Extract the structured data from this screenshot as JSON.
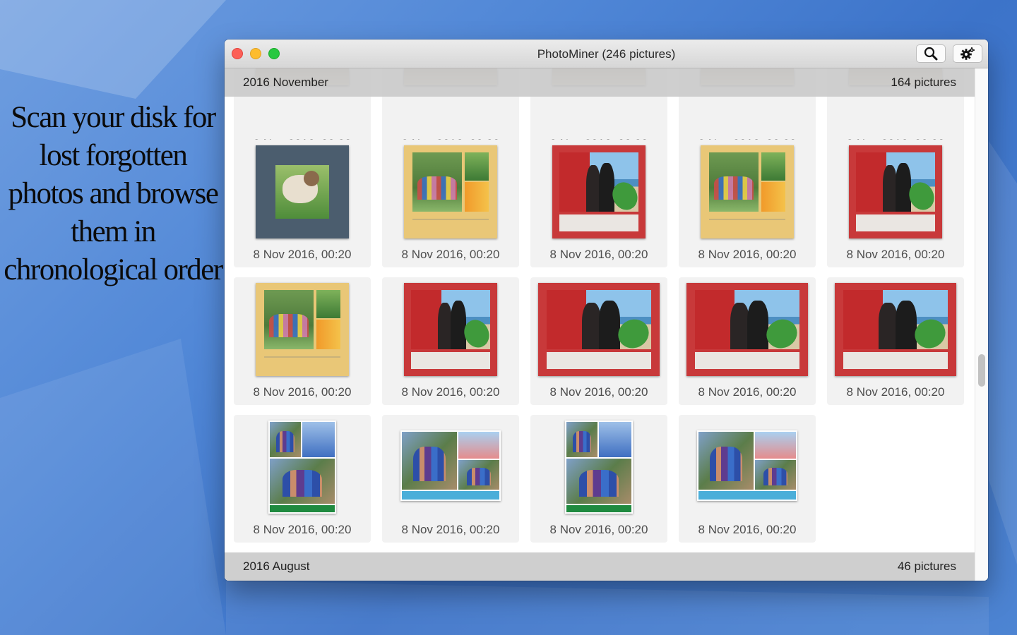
{
  "promo_text": "Scan your disk for lost forgotten photos and browse them in chronological order",
  "window": {
    "title": "PhotoMiner (246 pictures)"
  },
  "toolbar": {
    "search_icon": "search-icon",
    "settings_icon": "gear-icon"
  },
  "sections": [
    {
      "label": "2016 November",
      "count": "164 pictures"
    },
    {
      "label": "2016 August",
      "count": "46 pictures"
    }
  ],
  "photo_date": "8 Nov 2016, 00:20",
  "rows": [
    [
      "cover-partial",
      "cover-partial",
      "cover-partial",
      "cover-partial",
      "cover-partial"
    ],
    [
      "slate-dog",
      "yellow-kids",
      "red-beach",
      "yellow-kids",
      "red-beach"
    ],
    [
      "yellow-kids",
      "red-beach",
      "red-beach-wide",
      "red-beach-wide",
      "red-beach-wide"
    ],
    [
      "collage-tall",
      "collage-wide",
      "collage-tall",
      "collage-wide"
    ]
  ],
  "colors": {
    "accent_red": "#c8393a",
    "accent_yellow": "#e9c777",
    "slate": "#4b5d6e"
  }
}
